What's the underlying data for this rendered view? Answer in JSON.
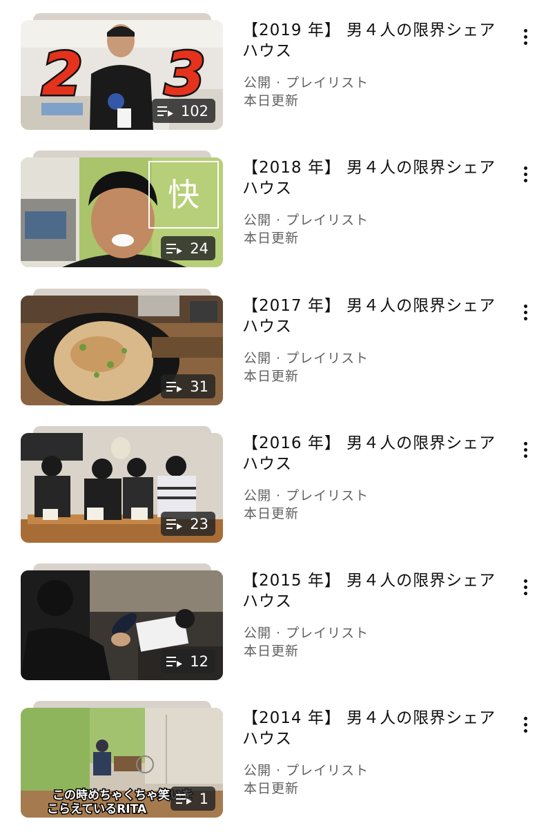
{
  "playlists": [
    {
      "title": "【2019 年】 男４人の限界シェアハウス",
      "visibility": "公開 · プレイリスト",
      "updated": "本日更新",
      "count": "102"
    },
    {
      "title": "【2018 年】 男４人の限界シェアハウス",
      "visibility": "公開 · プレイリスト",
      "updated": "本日更新",
      "count": "24"
    },
    {
      "title": "【2017 年】 男４人の限界シェアハウス",
      "visibility": "公開 · プレイリスト",
      "updated": "本日更新",
      "count": "31"
    },
    {
      "title": "【2016 年】 男４人の限界シェアハウス",
      "visibility": "公開 · プレイリスト",
      "updated": "本日更新",
      "count": "23"
    },
    {
      "title": "【2015 年】 男４人の限界シェアハウス",
      "visibility": "公開 · プレイリスト",
      "updated": "本日更新",
      "count": "12"
    },
    {
      "title": "【2014 年】 男４人の限界シェアハウス",
      "visibility": "公開 · プレイリスト",
      "updated": "本日更新",
      "count": "1"
    }
  ],
  "thumb_text": {
    "t2019_left": "2",
    "t2019_right": "3",
    "t2018_kanji": "快",
    "t2014_caption_1": "この時めちゃくちゃ笑いを",
    "t2014_caption_2": "こらえているRITA"
  },
  "icons": {
    "count_icon": "playlist-icon",
    "menu_icon": "more-vert-icon"
  },
  "colors": {
    "meta_text": "#606060",
    "count_badge": "#232323",
    "stack_edge": "#d8d2cb"
  }
}
